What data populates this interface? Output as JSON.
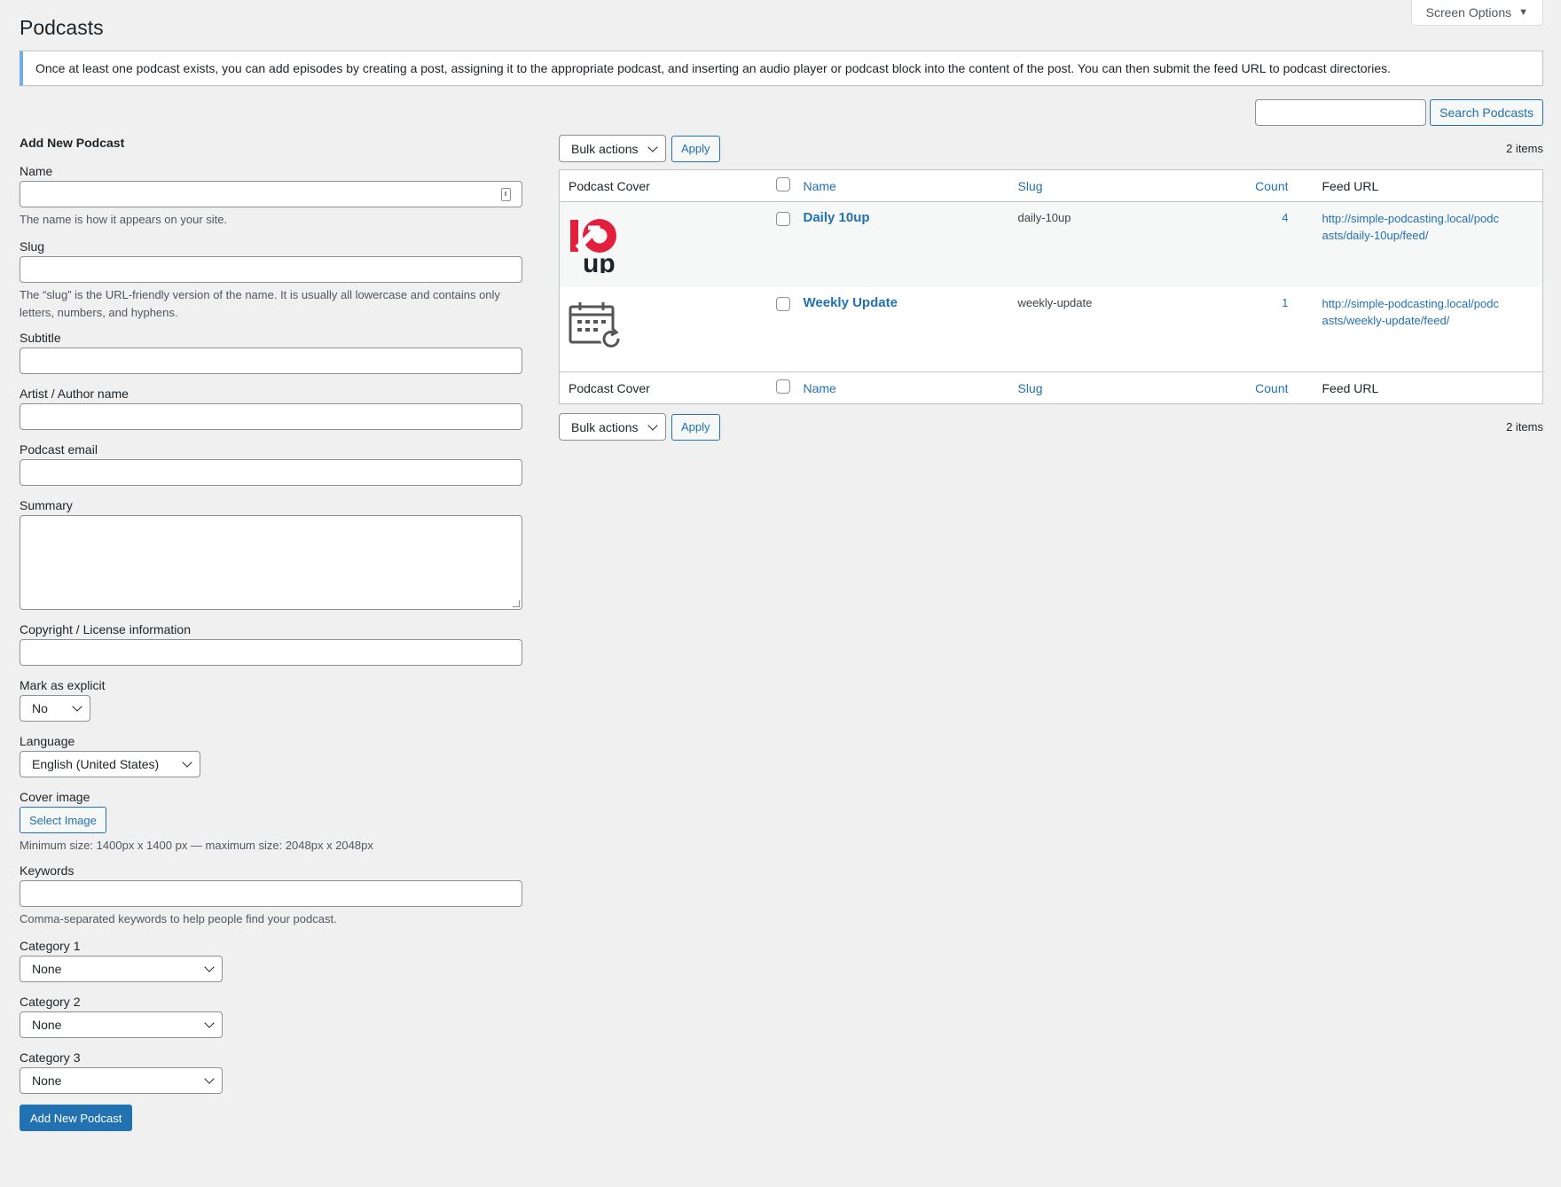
{
  "screen_options": {
    "label": "Screen Options",
    "caret": "▼"
  },
  "page_title": "Podcasts",
  "notice": "Once at least one podcast exists, you can add episodes by creating a post, assigning it to the appropriate podcast, and inserting an audio player or podcast block into the content of the post. You can then submit the feed URL to podcast directories.",
  "search": {
    "button_label": "Search Podcasts",
    "value": ""
  },
  "form": {
    "heading": "Add New Podcast",
    "name_label": "Name",
    "name_desc": "The name is how it appears on your site.",
    "slug_label": "Slug",
    "slug_desc": "The “slug” is the URL-friendly version of the name. It is usually all lowercase and contains only letters, numbers, and hyphens.",
    "subtitle_label": "Subtitle",
    "author_label": "Artist / Author name",
    "email_label": "Podcast email",
    "summary_label": "Summary",
    "copyright_label": "Copyright / License information",
    "explicit_label": "Mark as explicit",
    "explicit_value": "No",
    "language_label": "Language",
    "language_value": "English (United States)",
    "cover_label": "Cover image",
    "select_image": "Select Image",
    "cover_desc": "Minimum size: 1400px x 1400 px — maximum size: 2048px x 2048px",
    "keywords_label": "Keywords",
    "keywords_desc": "Comma-separated keywords to help people find your podcast.",
    "cat1_label": "Category 1",
    "cat1_value": "None",
    "cat2_label": "Category 2",
    "cat2_value": "None",
    "cat3_label": "Category 3",
    "cat3_value": "None",
    "submit": "Add New Podcast"
  },
  "list": {
    "bulk_actions": "Bulk actions",
    "apply": "Apply",
    "items_count": "2 items",
    "columns": {
      "cover": "Podcast Cover",
      "name": "Name",
      "slug": "Slug",
      "count": "Count",
      "feed": "Feed URL"
    },
    "rows": [
      {
        "name": "Daily 10up",
        "slug": "daily-10up",
        "count": "4",
        "feed": "http://simple-podcasting.local/podcasts/daily-10up/feed/",
        "cover_icon": "10up-logo-icon"
      },
      {
        "name": "Weekly Update",
        "slug": "weekly-update",
        "count": "1",
        "feed": "http://simple-podcasting.local/podcasts/weekly-update/feed/",
        "cover_icon": "calendar-refresh-icon"
      }
    ]
  },
  "colors": {
    "accent": "#2271b1",
    "notice_border": "#72aee6",
    "logo_red": "#e21f3c"
  }
}
